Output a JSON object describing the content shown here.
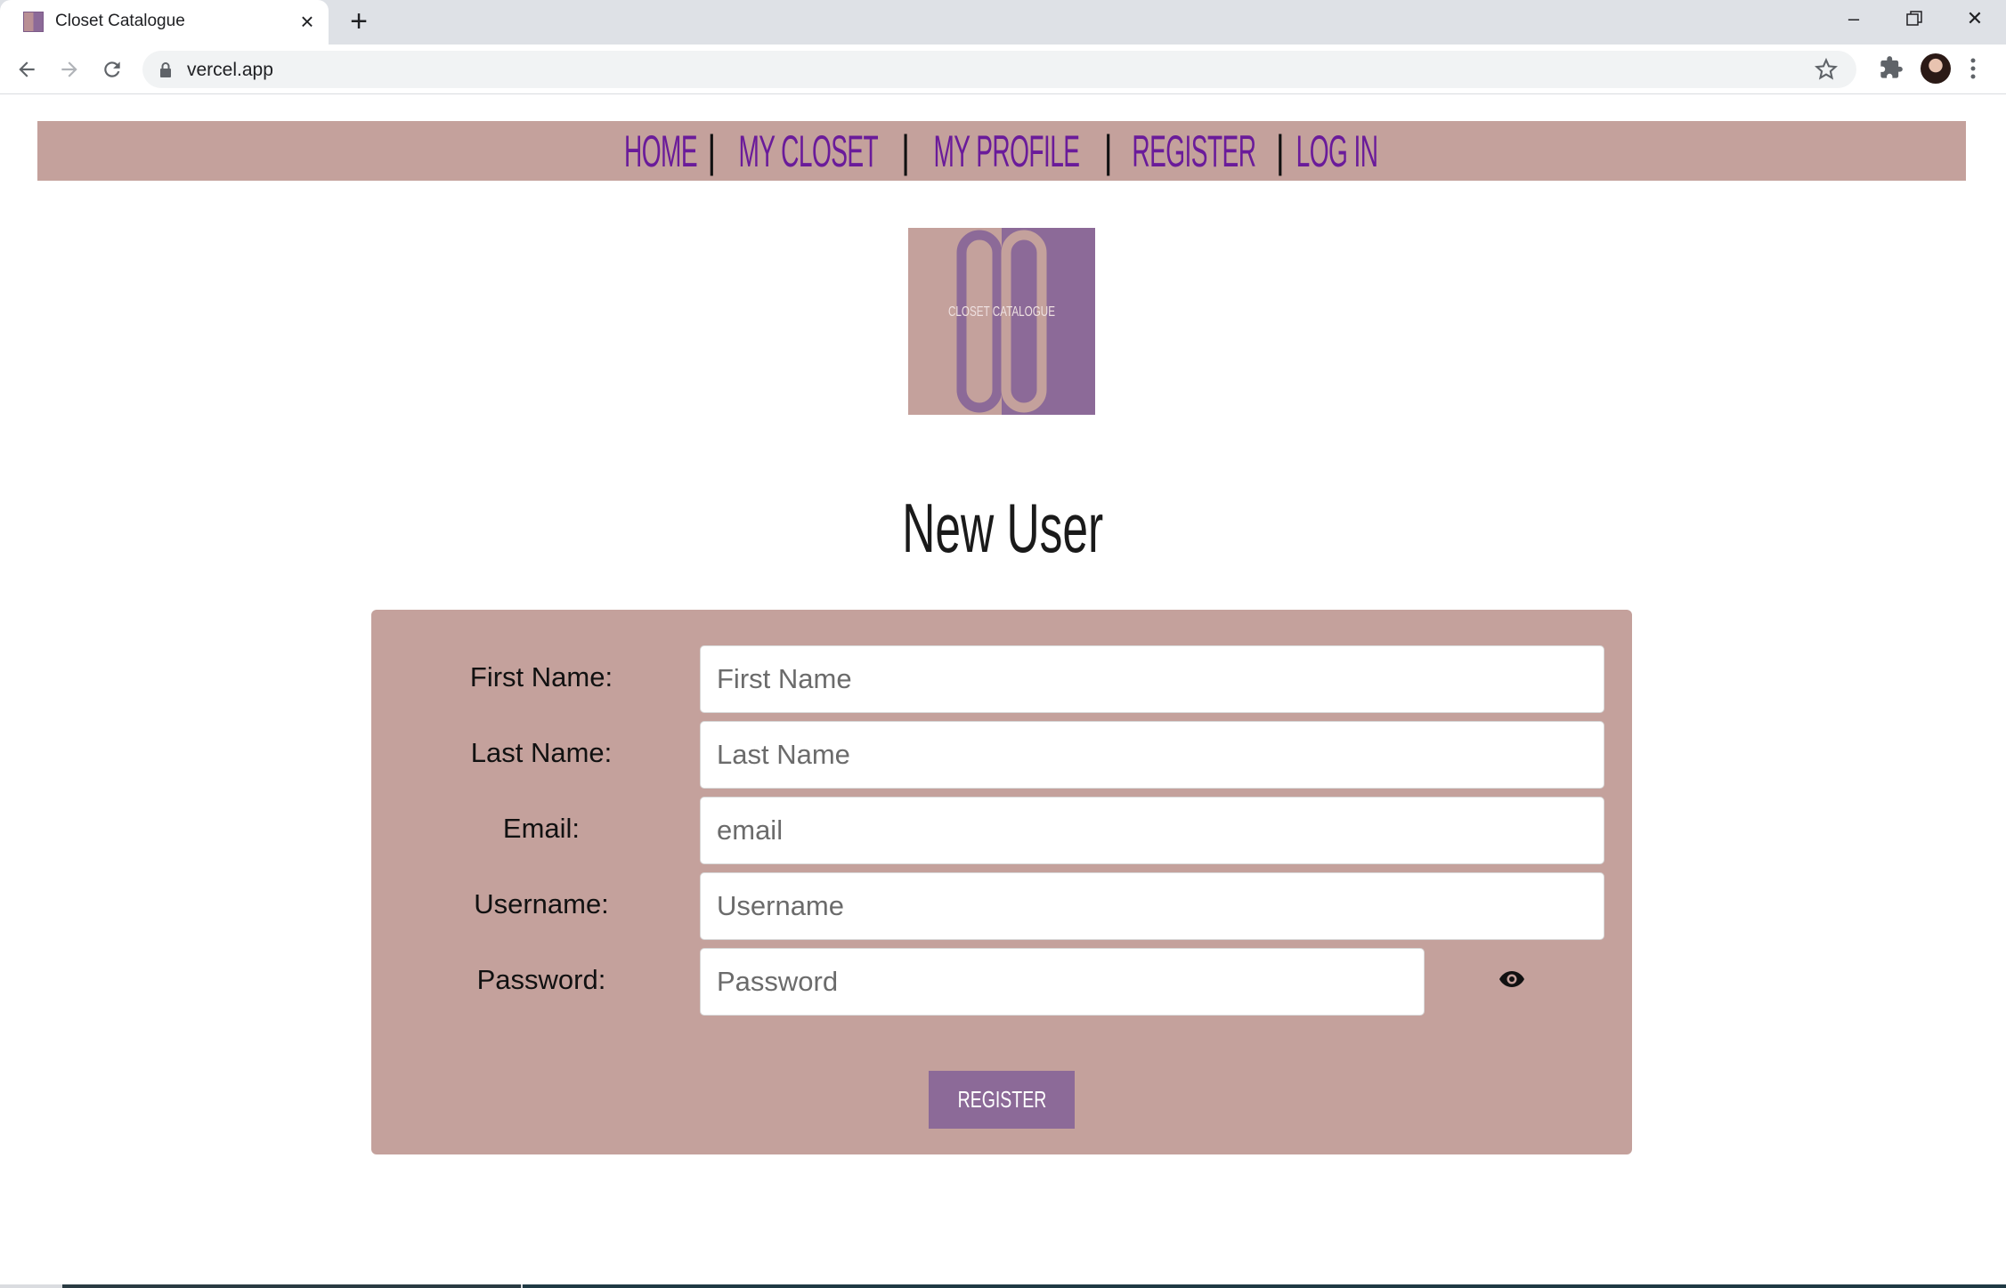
{
  "browser": {
    "tab_title": "Closet Catalogue",
    "url": "vercel.app"
  },
  "navbar": {
    "items": [
      {
        "label": "HOME"
      },
      {
        "label": "MY CLOSET"
      },
      {
        "label": "MY PROFILE"
      },
      {
        "label": "REGISTER"
      },
      {
        "label": "LOG IN"
      }
    ],
    "separator": "|",
    "link_color": "#6a1b9a",
    "background": "#c4a19c"
  },
  "logo": {
    "text": "CLOSET CATALOGUE",
    "colors": [
      "#c4a19c",
      "#8c6a98"
    ]
  },
  "page": {
    "title": "New User"
  },
  "form": {
    "fields": [
      {
        "label": "First Name:",
        "placeholder": "First Name",
        "value": ""
      },
      {
        "label": "Last Name:",
        "placeholder": "Last Name",
        "value": ""
      },
      {
        "label": "Email:",
        "placeholder": "email",
        "value": ""
      },
      {
        "label": "Username:",
        "placeholder": "Username",
        "value": ""
      },
      {
        "label": "Password:",
        "placeholder": "Password",
        "value": ""
      }
    ],
    "show_password_icon": "eye-icon",
    "submit_label": "REGISTER",
    "button_color": "#8c6a98"
  }
}
